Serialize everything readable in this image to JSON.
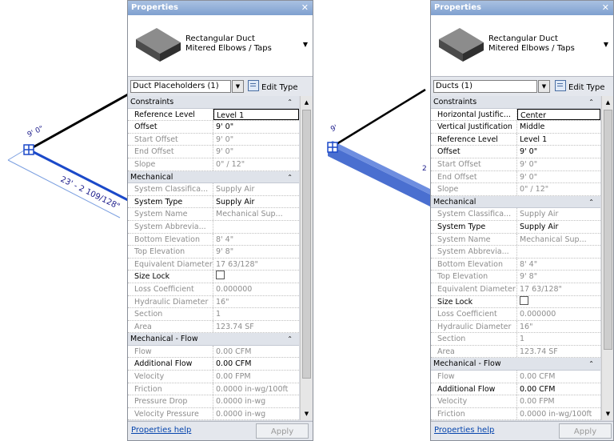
{
  "left_panel": {
    "title": "Properties",
    "close": "✕",
    "type_name_1": "Rectangular Duct",
    "type_name_2": "Mitered Elbows / Taps",
    "selector": "Duct Placeholders (1)",
    "edit_type": "Edit Type",
    "rows": [
      {
        "kind": "header",
        "label": "Constraints"
      },
      {
        "kind": "prop",
        "label": "Reference Level",
        "value": "Level 1",
        "style": "edit"
      },
      {
        "kind": "prop",
        "label": "Offset",
        "value": "9'  0\"",
        "style": "normal"
      },
      {
        "kind": "prop",
        "label": "Start Offset",
        "value": "9'  0\"",
        "style": "gray"
      },
      {
        "kind": "prop",
        "label": "End Offset",
        "value": "9'  0\"",
        "style": "gray"
      },
      {
        "kind": "prop",
        "label": "Slope",
        "value": "0\" / 12\"",
        "style": "gray"
      },
      {
        "kind": "header",
        "label": "Mechanical"
      },
      {
        "kind": "prop",
        "label": "System Classifica...",
        "value": "Supply Air",
        "style": "gray"
      },
      {
        "kind": "prop",
        "label": "System Type",
        "value": "Supply Air",
        "style": "normal"
      },
      {
        "kind": "prop",
        "label": "System Name",
        "value": "Mechanical Sup...",
        "style": "gray"
      },
      {
        "kind": "prop",
        "label": "System Abbrevia...",
        "value": "",
        "style": "gray"
      },
      {
        "kind": "prop",
        "label": "Bottom Elevation",
        "value": "8'  4\"",
        "style": "gray"
      },
      {
        "kind": "prop",
        "label": "Top Elevation",
        "value": "9'  8\"",
        "style": "gray"
      },
      {
        "kind": "prop",
        "label": "Equivalent Diameter",
        "value": "17 63/128\"",
        "style": "gray"
      },
      {
        "kind": "prop",
        "label": "Size Lock",
        "value": "",
        "style": "check"
      },
      {
        "kind": "prop",
        "label": "Loss Coefficient",
        "value": "0.000000",
        "style": "gray"
      },
      {
        "kind": "prop",
        "label": "Hydraulic Diameter",
        "value": "16\"",
        "style": "gray"
      },
      {
        "kind": "prop",
        "label": "Section",
        "value": "1",
        "style": "gray"
      },
      {
        "kind": "prop",
        "label": "Area",
        "value": "123.74 SF",
        "style": "gray"
      },
      {
        "kind": "header",
        "label": "Mechanical - Flow"
      },
      {
        "kind": "prop",
        "label": "Flow",
        "value": "0.00 CFM",
        "style": "gray"
      },
      {
        "kind": "prop",
        "label": "Additional Flow",
        "value": "0.00 CFM",
        "style": "normal"
      },
      {
        "kind": "prop",
        "label": "Velocity",
        "value": "0.00 FPM",
        "style": "gray"
      },
      {
        "kind": "prop",
        "label": "Friction",
        "value": "0.0000 in-wg/100ft",
        "style": "gray"
      },
      {
        "kind": "prop",
        "label": "Pressure Drop",
        "value": "0.0000 in-wg",
        "style": "gray"
      },
      {
        "kind": "prop",
        "label": "Velocity Pressure",
        "value": "0.0000 in-wg",
        "style": "gray"
      }
    ],
    "help": "Properties help",
    "apply": "Apply"
  },
  "right_panel": {
    "title": "Properties",
    "close": "✕",
    "type_name_1": "Rectangular Duct",
    "type_name_2": "Mitered Elbows / Taps",
    "selector": "Ducts (1)",
    "edit_type": "Edit Type",
    "rows": [
      {
        "kind": "header",
        "label": "Constraints"
      },
      {
        "kind": "prop",
        "label": "Horizontal Justific...",
        "value": "Center",
        "style": "edit"
      },
      {
        "kind": "prop",
        "label": "Vertical Justification",
        "value": "Middle",
        "style": "normal"
      },
      {
        "kind": "prop",
        "label": "Reference Level",
        "value": "Level 1",
        "style": "normal"
      },
      {
        "kind": "prop",
        "label": "Offset",
        "value": "9'  0\"",
        "style": "normal"
      },
      {
        "kind": "prop",
        "label": "Start Offset",
        "value": "9'  0\"",
        "style": "gray"
      },
      {
        "kind": "prop",
        "label": "End Offset",
        "value": "9'  0\"",
        "style": "gray"
      },
      {
        "kind": "prop",
        "label": "Slope",
        "value": "0\" / 12\"",
        "style": "gray"
      },
      {
        "kind": "header",
        "label": "Mechanical"
      },
      {
        "kind": "prop",
        "label": "System Classifica...",
        "value": "Supply Air",
        "style": "gray"
      },
      {
        "kind": "prop",
        "label": "System Type",
        "value": "Supply Air",
        "style": "normal"
      },
      {
        "kind": "prop",
        "label": "System Name",
        "value": "Mechanical Sup...",
        "style": "gray"
      },
      {
        "kind": "prop",
        "label": "System Abbrevia...",
        "value": "",
        "style": "gray"
      },
      {
        "kind": "prop",
        "label": "Bottom Elevation",
        "value": "8'  4\"",
        "style": "gray"
      },
      {
        "kind": "prop",
        "label": "Top Elevation",
        "value": "9'  8\"",
        "style": "gray"
      },
      {
        "kind": "prop",
        "label": "Equivalent Diameter",
        "value": "17 63/128\"",
        "style": "gray"
      },
      {
        "kind": "prop",
        "label": "Size Lock",
        "value": "",
        "style": "check"
      },
      {
        "kind": "prop",
        "label": "Loss Coefficient",
        "value": "0.000000",
        "style": "gray"
      },
      {
        "kind": "prop",
        "label": "Hydraulic Diameter",
        "value": "16\"",
        "style": "gray"
      },
      {
        "kind": "prop",
        "label": "Section",
        "value": "1",
        "style": "gray"
      },
      {
        "kind": "prop",
        "label": "Area",
        "value": "123.74 SF",
        "style": "gray"
      },
      {
        "kind": "header",
        "label": "Mechanical - Flow"
      },
      {
        "kind": "prop",
        "label": "Flow",
        "value": "0.00 CFM",
        "style": "gray"
      },
      {
        "kind": "prop",
        "label": "Additional Flow",
        "value": "0.00 CFM",
        "style": "normal"
      },
      {
        "kind": "prop",
        "label": "Velocity",
        "value": "0.00 FPM",
        "style": "gray"
      },
      {
        "kind": "prop",
        "label": "Friction",
        "value": "0.0000 in-wg/100ft",
        "style": "gray"
      }
    ],
    "help": "Properties help",
    "apply": "Apply"
  },
  "canvas": {
    "left_dim_label": "9'  0\"",
    "left_length_label": "23' - 2 109/128\"",
    "right_dim_label": "9'",
    "right_partial": "2",
    "duct_color": "#4a6fd0"
  }
}
